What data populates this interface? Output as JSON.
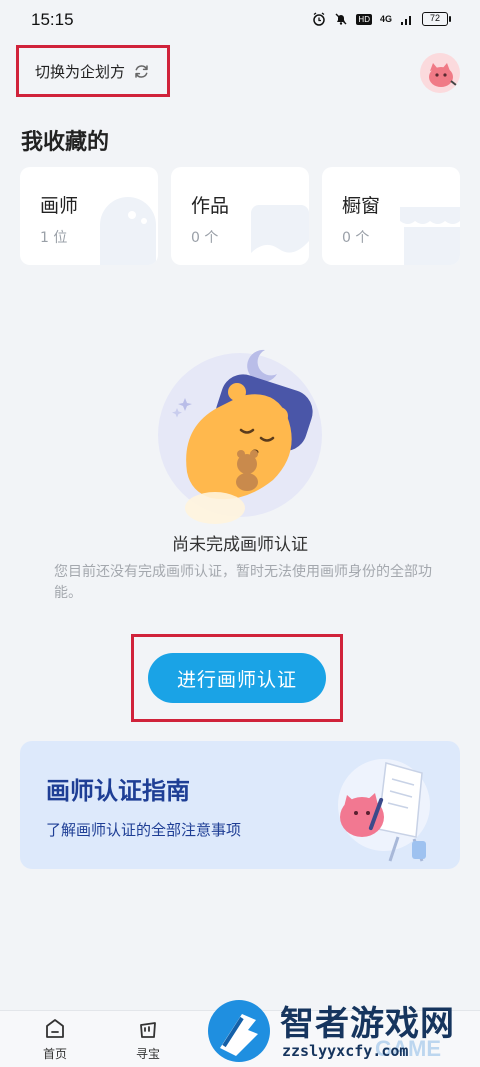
{
  "status_bar": {
    "time": "15:15",
    "network": "4G",
    "hd": "HD",
    "battery": "72"
  },
  "header": {
    "switch_label": "切换为企划方"
  },
  "favorites": {
    "title": "我收藏的",
    "cards": [
      {
        "name": "画师",
        "count": "1 位"
      },
      {
        "name": "作品",
        "count": "0 个"
      },
      {
        "name": "橱窗",
        "count": "0 个"
      }
    ]
  },
  "empty_state": {
    "title": "尚未完成画师认证",
    "description": "您目前还没有完成画师认证，暂时无法使用画师身份的全部功能。"
  },
  "certify_button": {
    "label": "进行画师认证"
  },
  "guide": {
    "title": "画师认证指南",
    "description": "了解画师认证的全部注意事项"
  },
  "bottom_nav": [
    {
      "label": "首页"
    },
    {
      "label": "寻宝"
    }
  ],
  "watermark": {
    "name": "智者游戏网",
    "url": "zzslyyxcfy.com",
    "overlay": "GAME"
  },
  "colors": {
    "accent": "#1aa3e6",
    "highlight_border": "#d0223a",
    "guide_text": "#1e3e95"
  }
}
